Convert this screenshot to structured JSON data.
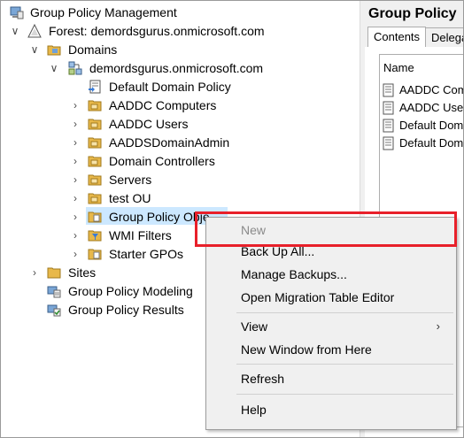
{
  "tree": {
    "root_label": "Group Policy Management",
    "forest_label": "Forest: demordsgurus.onmicrosoft.com",
    "domains_label": "Domains",
    "domain_label": "demordsgurus.onmicrosoft.com",
    "children": [
      "Default Domain Policy",
      "AADDC Computers",
      "AADDC Users",
      "AADDSDomainAdmin",
      "Domain Controllers",
      "Servers",
      "test OU",
      "Group Policy Obje",
      "WMI Filters",
      "Starter GPOs"
    ],
    "sites_label": "Sites",
    "modeling_label": "Group Policy Modeling",
    "results_label": "Group Policy Results"
  },
  "right_pane": {
    "title": "Group Policy",
    "tabs": [
      "Contents",
      "Delega"
    ],
    "column_header": "Name",
    "rows": [
      "AADDC Com",
      "AADDC Use",
      "Default Dom",
      "Default Dom"
    ]
  },
  "context_menu": {
    "items": [
      {
        "label": "New",
        "disabled": true
      },
      {
        "label": "Back Up All..."
      },
      {
        "label": "Manage Backups..."
      },
      {
        "label": "Open Migration Table Editor"
      },
      {
        "label": "View",
        "submenu_arrow": "›"
      },
      {
        "label": "New Window from Here"
      },
      {
        "label": "Refresh"
      },
      {
        "label": "Help"
      }
    ]
  },
  "colors": {
    "highlight": "#e8202a",
    "selection": "#cce8ff",
    "folder": "#e8b84a",
    "menu_bg": "#f0f0f0"
  }
}
